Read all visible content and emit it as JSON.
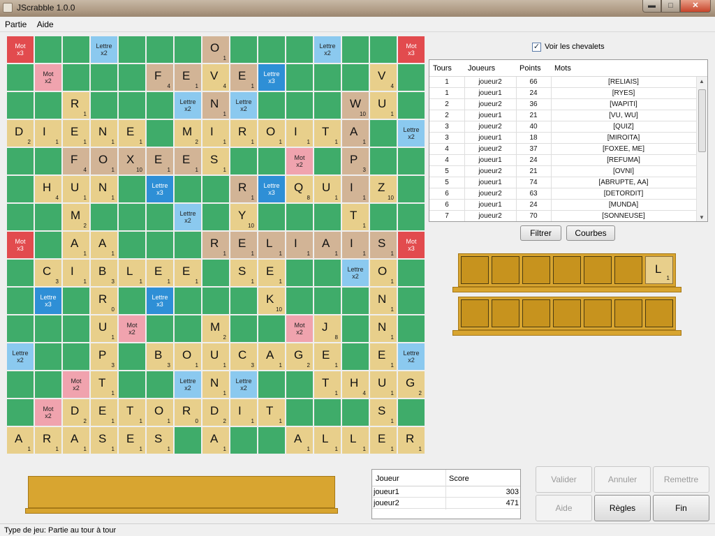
{
  "window": {
    "title": "JScrabble 1.0.0",
    "min_label": "▬",
    "max_label": "□",
    "close_label": "✕"
  },
  "menu": {
    "items": [
      "Partie",
      "Aide"
    ]
  },
  "colors": {
    "normal": "#3fac6a",
    "double_word": "#f0a3ae",
    "triple_word": "#e24b4e",
    "double_letter": "#8bc9ef",
    "triple_letter": "#2e8fd6",
    "tile": "#e8cf8b",
    "recent_tile": "#d2b496",
    "rack": "#d8a530"
  },
  "premium_labels": {
    "tw": "Mot\nx3",
    "dw": "Mot\nx2",
    "tl": "Lettre\nx3",
    "dl": "Lettre\nx2"
  },
  "board": {
    "premium_rows": [
      "tw . . dl . . . tw . . . dl . . tw",
      ". dw . . . tl . . . tl . . . dw .",
      ". . dw . . . dl . dl . . . dw . .",
      "dl . . dw . . . dl . . . dw . . dl",
      ". . . . dw . . . . . dw . . . .",
      ". tl . . . tl . . . tl . . . tl .",
      ". . dl . . . dl . dl . . . dl . .",
      "tw . . dl . . . dw . . . dl . . tw",
      ". . dl . . . dl . dl . . . dl . .",
      ". tl . . . tl . . . tl . . . tl .",
      ". . . . dw . . . . . dw . . . .",
      "dl . . dw . . . dl . . . dw . . dl",
      ". . dw . . . dl . dl . . . dw . .",
      ". dw . . . tl . . . tl . . . dw .",
      "tw . . dl . . . tw . . . dl . . tw"
    ],
    "tiles": [
      {
        "r": 0,
        "c": 7,
        "l": "O",
        "p": 1,
        "recent": true
      },
      {
        "r": 1,
        "c": 5,
        "l": "F",
        "p": 4,
        "recent": true
      },
      {
        "r": 1,
        "c": 6,
        "l": "E",
        "p": 1,
        "recent": true
      },
      {
        "r": 1,
        "c": 7,
        "l": "V",
        "p": 4
      },
      {
        "r": 1,
        "c": 8,
        "l": "E",
        "p": 1,
        "recent": true
      },
      {
        "r": 1,
        "c": 13,
        "l": "V",
        "p": 4
      },
      {
        "r": 2,
        "c": 2,
        "l": "R",
        "p": 1
      },
      {
        "r": 2,
        "c": 7,
        "l": "N",
        "p": 1,
        "recent": true
      },
      {
        "r": 2,
        "c": 12,
        "l": "W",
        "p": 10,
        "recent": true
      },
      {
        "r": 2,
        "c": 13,
        "l": "U",
        "p": 1
      },
      {
        "r": 3,
        "c": 0,
        "l": "D",
        "p": 2
      },
      {
        "r": 3,
        "c": 1,
        "l": "I",
        "p": 1
      },
      {
        "r": 3,
        "c": 2,
        "l": "E",
        "p": 1
      },
      {
        "r": 3,
        "c": 3,
        "l": "N",
        "p": 1
      },
      {
        "r": 3,
        "c": 4,
        "l": "E",
        "p": 1
      },
      {
        "r": 3,
        "c": 6,
        "l": "M",
        "p": 2
      },
      {
        "r": 3,
        "c": 7,
        "l": "I",
        "p": 1
      },
      {
        "r": 3,
        "c": 8,
        "l": "R",
        "p": 1
      },
      {
        "r": 3,
        "c": 9,
        "l": "O",
        "p": 1
      },
      {
        "r": 3,
        "c": 10,
        "l": "I",
        "p": 1
      },
      {
        "r": 3,
        "c": 11,
        "l": "T",
        "p": 1
      },
      {
        "r": 3,
        "c": 12,
        "l": "A",
        "p": 1,
        "recent": true
      },
      {
        "r": 4,
        "c": 2,
        "l": "F",
        "p": 4,
        "recent": true
      },
      {
        "r": 4,
        "c": 3,
        "l": "O",
        "p": 1,
        "recent": true
      },
      {
        "r": 4,
        "c": 4,
        "l": "X",
        "p": 10,
        "recent": true
      },
      {
        "r": 4,
        "c": 5,
        "l": "E",
        "p": 1,
        "recent": true
      },
      {
        "r": 4,
        "c": 6,
        "l": "E",
        "p": 1,
        "recent": true
      },
      {
        "r": 4,
        "c": 7,
        "l": "S",
        "p": 1
      },
      {
        "r": 4,
        "c": 12,
        "l": "P",
        "p": 3,
        "recent": true
      },
      {
        "r": 5,
        "c": 1,
        "l": "H",
        "p": 4
      },
      {
        "r": 5,
        "c": 2,
        "l": "U",
        "p": 1
      },
      {
        "r": 5,
        "c": 3,
        "l": "N",
        "p": 1
      },
      {
        "r": 5,
        "c": 8,
        "l": "R",
        "p": 1,
        "recent": true
      },
      {
        "r": 5,
        "c": 10,
        "l": "Q",
        "p": 8
      },
      {
        "r": 5,
        "c": 11,
        "l": "U",
        "p": 1
      },
      {
        "r": 5,
        "c": 12,
        "l": "I",
        "p": 1,
        "recent": true
      },
      {
        "r": 5,
        "c": 13,
        "l": "Z",
        "p": 10
      },
      {
        "r": 6,
        "c": 2,
        "l": "M",
        "p": 2
      },
      {
        "r": 6,
        "c": 8,
        "l": "Y",
        "p": 10
      },
      {
        "r": 6,
        "c": 12,
        "l": "T",
        "p": 1
      },
      {
        "r": 7,
        "c": 2,
        "l": "A",
        "p": 1
      },
      {
        "r": 7,
        "c": 3,
        "l": "A",
        "p": 1
      },
      {
        "r": 7,
        "c": 7,
        "l": "R",
        "p": 1,
        "recent": true
      },
      {
        "r": 7,
        "c": 8,
        "l": "E",
        "p": 1,
        "recent": true
      },
      {
        "r": 7,
        "c": 9,
        "l": "L",
        "p": 1,
        "recent": true
      },
      {
        "r": 7,
        "c": 10,
        "l": "I",
        "p": 1,
        "recent": true
      },
      {
        "r": 7,
        "c": 11,
        "l": "A",
        "p": 1,
        "recent": true
      },
      {
        "r": 7,
        "c": 12,
        "l": "I",
        "p": 1,
        "recent": true
      },
      {
        "r": 7,
        "c": 13,
        "l": "S",
        "p": 1,
        "recent": true
      },
      {
        "r": 8,
        "c": 1,
        "l": "C",
        "p": 3
      },
      {
        "r": 8,
        "c": 2,
        "l": "I",
        "p": 1
      },
      {
        "r": 8,
        "c": 3,
        "l": "B",
        "p": 3
      },
      {
        "r": 8,
        "c": 4,
        "l": "L",
        "p": 1
      },
      {
        "r": 8,
        "c": 5,
        "l": "E",
        "p": 1
      },
      {
        "r": 8,
        "c": 6,
        "l": "E",
        "p": 1
      },
      {
        "r": 8,
        "c": 8,
        "l": "S",
        "p": 1
      },
      {
        "r": 8,
        "c": 9,
        "l": "E",
        "p": 1
      },
      {
        "r": 8,
        "c": 13,
        "l": "O",
        "p": 1
      },
      {
        "r": 9,
        "c": 3,
        "l": "R",
        "p": 0
      },
      {
        "r": 9,
        "c": 9,
        "l": "K",
        "p": 10
      },
      {
        "r": 9,
        "c": 13,
        "l": "N",
        "p": 1
      },
      {
        "r": 10,
        "c": 3,
        "l": "U",
        "p": 1
      },
      {
        "r": 10,
        "c": 7,
        "l": "M",
        "p": 2
      },
      {
        "r": 10,
        "c": 11,
        "l": "J",
        "p": 8
      },
      {
        "r": 10,
        "c": 13,
        "l": "N",
        "p": 1
      },
      {
        "r": 11,
        "c": 3,
        "l": "P",
        "p": 3
      },
      {
        "r": 11,
        "c": 5,
        "l": "B",
        "p": 3
      },
      {
        "r": 11,
        "c": 6,
        "l": "O",
        "p": 1
      },
      {
        "r": 11,
        "c": 7,
        "l": "U",
        "p": 1
      },
      {
        "r": 11,
        "c": 8,
        "l": "C",
        "p": 3
      },
      {
        "r": 11,
        "c": 9,
        "l": "A",
        "p": 1
      },
      {
        "r": 11,
        "c": 10,
        "l": "G",
        "p": 2
      },
      {
        "r": 11,
        "c": 11,
        "l": "E",
        "p": 1
      },
      {
        "r": 11,
        "c": 13,
        "l": "E",
        "p": 1
      },
      {
        "r": 12,
        "c": 3,
        "l": "T",
        "p": 1
      },
      {
        "r": 12,
        "c": 7,
        "l": "N",
        "p": 1
      },
      {
        "r": 12,
        "c": 11,
        "l": "T",
        "p": 1
      },
      {
        "r": 12,
        "c": 12,
        "l": "H",
        "p": 4
      },
      {
        "r": 12,
        "c": 13,
        "l": "U",
        "p": 1
      },
      {
        "r": 12,
        "c": 14,
        "l": "G",
        "p": 2
      },
      {
        "r": 13,
        "c": 2,
        "l": "D",
        "p": 2
      },
      {
        "r": 13,
        "c": 3,
        "l": "E",
        "p": 1
      },
      {
        "r": 13,
        "c": 4,
        "l": "T",
        "p": 1
      },
      {
        "r": 13,
        "c": 5,
        "l": "O",
        "p": 1
      },
      {
        "r": 13,
        "c": 6,
        "l": "R",
        "p": 0
      },
      {
        "r": 13,
        "c": 7,
        "l": "D",
        "p": 2
      },
      {
        "r": 13,
        "c": 8,
        "l": "I",
        "p": 1
      },
      {
        "r": 13,
        "c": 9,
        "l": "T",
        "p": 1
      },
      {
        "r": 13,
        "c": 13,
        "l": "S",
        "p": 1
      },
      {
        "r": 14,
        "c": 0,
        "l": "A",
        "p": 1
      },
      {
        "r": 14,
        "c": 1,
        "l": "R",
        "p": 1
      },
      {
        "r": 14,
        "c": 2,
        "l": "A",
        "p": 1
      },
      {
        "r": 14,
        "c": 3,
        "l": "S",
        "p": 1
      },
      {
        "r": 14,
        "c": 4,
        "l": "E",
        "p": 1
      },
      {
        "r": 14,
        "c": 5,
        "l": "S",
        "p": 1
      },
      {
        "r": 14,
        "c": 7,
        "l": "A",
        "p": 1
      },
      {
        "r": 14,
        "c": 10,
        "l": "A",
        "p": 1
      },
      {
        "r": 14,
        "c": 11,
        "l": "L",
        "p": 1
      },
      {
        "r": 14,
        "c": 12,
        "l": "L",
        "p": 1
      },
      {
        "r": 14,
        "c": 13,
        "l": "E",
        "p": 1
      },
      {
        "r": 14,
        "c": 14,
        "l": "R",
        "p": 1
      }
    ]
  },
  "show_racks": {
    "label": "Voir les chevalets",
    "checked": true
  },
  "history": {
    "columns": [
      "Tours",
      "Joueurs",
      "Points",
      "Mots"
    ],
    "rows": [
      [
        "1",
        "joueur2",
        "66",
        "[RELIAIS]"
      ],
      [
        "1",
        "joueur1",
        "24",
        "[RYES]"
      ],
      [
        "2",
        "joueur2",
        "36",
        "[WAPITI]"
      ],
      [
        "2",
        "joueur1",
        "21",
        "[VU, WU]"
      ],
      [
        "3",
        "joueur2",
        "40",
        "[QUIZ]"
      ],
      [
        "3",
        "joueur1",
        "18",
        "[MIROITA]"
      ],
      [
        "4",
        "joueur2",
        "37",
        "[FOXEE, ME]"
      ],
      [
        "4",
        "joueur1",
        "24",
        "[REFUMA]"
      ],
      [
        "5",
        "joueur2",
        "21",
        "[OVNI]"
      ],
      [
        "5",
        "joueur1",
        "74",
        "[ABRUPTE, AA]"
      ],
      [
        "6",
        "joueur2",
        "63",
        "[DETORDIT]"
      ],
      [
        "6",
        "joueur1",
        "24",
        "[MUNDA]"
      ],
      [
        "7",
        "joueur2",
        "70",
        "[SONNEUSE]"
      ]
    ]
  },
  "buttons": {
    "filtrer": "Filtrer",
    "courbes": "Courbes",
    "valider": "Valider",
    "annuler": "Annuler",
    "remettre": "Remettre",
    "aide": "Aide",
    "regles": "Règles",
    "fin": "Fin"
  },
  "racks": [
    {
      "tiles": [
        null,
        null,
        null,
        null,
        null,
        null,
        {
          "l": "L",
          "p": 1
        }
      ]
    },
    {
      "tiles": [
        null,
        null,
        null,
        null,
        null,
        null,
        null
      ]
    }
  ],
  "scores": {
    "columns": [
      "Joueur",
      "Score"
    ],
    "rows": [
      [
        "joueur1",
        "303"
      ],
      [
        "joueur2",
        "471"
      ]
    ]
  },
  "status": "Type de jeu: Partie au tour à tour"
}
